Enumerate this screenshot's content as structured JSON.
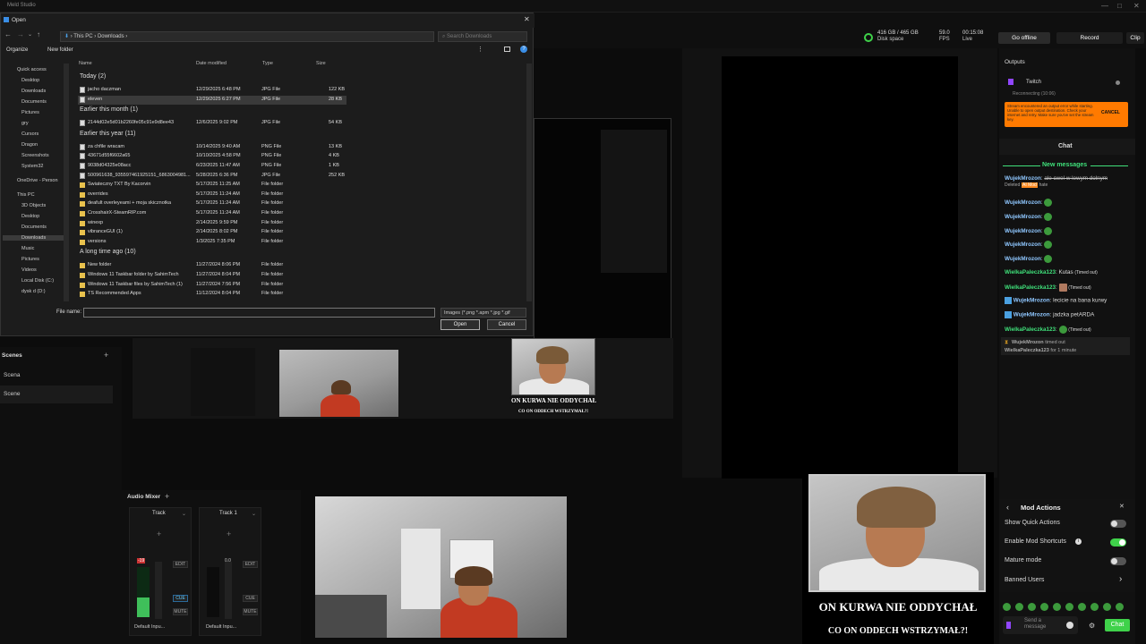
{
  "app": {
    "title": "Meld Studio"
  },
  "topbar": {
    "disk_space": "416 GB / 465 GB",
    "disk_label": "Disk space",
    "fps_value": "59.0",
    "fps_label": "FPS",
    "live_time": "00:15:08",
    "live_label": "Live",
    "go_offline": "Go offline",
    "record": "Record",
    "clip": "Clip"
  },
  "dialog": {
    "title": "Open",
    "breadcrumb": [
      "This PC",
      "Downloads"
    ],
    "search_placeholder": "Search Downloads",
    "organize": "Organize",
    "new_folder": "New folder",
    "columns": [
      "Name",
      "Date modified",
      "Type",
      "Size"
    ],
    "nav": [
      "Quick access",
      "Desktop",
      "Downloads",
      "Documents",
      "Pictures",
      "gry",
      "Cursors",
      "Dragon",
      "Screenshots",
      "System32",
      "OneDrive - Person",
      "This PC",
      "3D Objects",
      "Desktop",
      "Documents",
      "Downloads",
      "Music",
      "Pictures",
      "Videos",
      "Local Disk (C:)",
      "dysk d (D:)"
    ],
    "groups": [
      {
        "label": "Today (2)",
        "files": [
          {
            "name": "jacho daczman",
            "date": "12/29/2025 6:48 PM",
            "type": "JPG File",
            "size": "122 KB",
            "kind": "img"
          },
          {
            "name": "eleven",
            "date": "12/29/2025 6:27 PM",
            "type": "JPG File",
            "size": "28 KB",
            "kind": "img",
            "selected": true
          }
        ]
      },
      {
        "label": "Earlier this month (1)",
        "files": [
          {
            "name": "2144d02e5d01b2260fe05c91e9d8ee43",
            "date": "12/6/2025 9:02 PM",
            "type": "JPG File",
            "size": "54 KB",
            "kind": "img"
          }
        ]
      },
      {
        "label": "Earlier this year (11)",
        "files": [
          {
            "name": "za chfile wracam",
            "date": "10/14/2025 9:40 AM",
            "type": "PNG File",
            "size": "13 KB",
            "kind": "img"
          },
          {
            "name": "43671d55f6602a65",
            "date": "10/10/2025 4:58 PM",
            "type": "PNG File",
            "size": "4 KB",
            "kind": "img"
          },
          {
            "name": "9038d04325e08acc",
            "date": "6/23/2025 11:47 AM",
            "type": "PNG File",
            "size": "1 KB",
            "kind": "img"
          },
          {
            "name": "500961638_935597461925151_6863004981...",
            "date": "5/28/2025 6:36 PM",
            "type": "JPG File",
            "size": "252 KB",
            "kind": "img"
          },
          {
            "name": "Swiateczny TXT By Kacorvin",
            "date": "5/17/2025 11:25 AM",
            "type": "File folder",
            "size": "",
            "kind": "fold"
          },
          {
            "name": "overrides",
            "date": "5/17/2025 11:24 AM",
            "type": "File folder",
            "size": "",
            "kind": "fold"
          },
          {
            "name": "deafult overleyeami + moja skicznotka",
            "date": "5/17/2025 11:24 AM",
            "type": "File folder",
            "size": "",
            "kind": "fold"
          },
          {
            "name": "CrosshairX-SteamRIP.com",
            "date": "5/17/2025 11:24 AM",
            "type": "File folder",
            "size": "",
            "kind": "fold"
          },
          {
            "name": "winexp",
            "date": "2/14/2025 9:59 PM",
            "type": "File folder",
            "size": "",
            "kind": "fold"
          },
          {
            "name": "vibranceGUI (1)",
            "date": "2/14/2025 8:02 PM",
            "type": "File folder",
            "size": "",
            "kind": "fold"
          },
          {
            "name": "versions",
            "date": "1/3/2025 7:35 PM",
            "type": "File folder",
            "size": "",
            "kind": "fold"
          }
        ]
      },
      {
        "label": "A long time ago (10)",
        "files": [
          {
            "name": "New folder",
            "date": "11/27/2024 8:06 PM",
            "type": "File folder",
            "size": "",
            "kind": "fold"
          },
          {
            "name": "Windows 11 Taskbar folder by SahimTech",
            "date": "11/27/2024 8:04 PM",
            "type": "File folder",
            "size": "",
            "kind": "fold"
          },
          {
            "name": "Windows 11 Taskbar files by SahimTech (1)",
            "date": "11/27/2024 7:56 PM",
            "type": "File folder",
            "size": "",
            "kind": "fold"
          },
          {
            "name": "TS Recommended Apps",
            "date": "11/12/2024 8:04 PM",
            "type": "File folder",
            "size": "",
            "kind": "fold"
          }
        ]
      }
    ],
    "file_name_label": "File name:",
    "file_name_value": "",
    "file_type": "Images (*.png *.apm *.jpg *.gif",
    "open": "Open",
    "cancel": "Cancel"
  },
  "scenes": {
    "title": "Scenes",
    "items": [
      "Scena",
      "Scene"
    ]
  },
  "audio": {
    "title": "Audio Mixer",
    "tracks": [
      {
        "name": "Track",
        "level": "-19",
        "device": "Default Inpu..."
      },
      {
        "name": "Track 1",
        "level": "0.0",
        "device": "Default Inpu..."
      }
    ],
    "edit": "EDIT",
    "cue": "CUE",
    "mute": "MUTE"
  },
  "outputs": {
    "title": "Outputs",
    "service": "Twitch",
    "status": "Reconnecting (10:06)",
    "error": "Stream encountered an output error while starting. Unable to open output destination. Check your internet and retry. Make sure you've set the stream key.",
    "cancel": "CANCEL"
  },
  "chat": {
    "title": "Chat",
    "new_messages": "New messages",
    "messages": [
      {
        "user": "WujekMrozon",
        "text": "ale cwel w lewym dolnym",
        "tags": [
          "Deleted",
          "AI Mod",
          "hate"
        ]
      },
      {
        "user": "WujekMrozon",
        "text": ""
      },
      {
        "user": "WujekMrozon",
        "text": ""
      },
      {
        "user": "WujekMrozon",
        "text": ""
      },
      {
        "user": "WujekMrozon",
        "text": ""
      },
      {
        "user": "WujekMrozon",
        "text": ""
      },
      {
        "user": "WielkaPaleczka123",
        "text": "Kutas",
        "tags": [
          "Timed out"
        ]
      },
      {
        "user": "WielkaPaleczka123",
        "text": "",
        "tags": [
          "Timed out"
        ]
      },
      {
        "user": "WujekMrozon",
        "text": "lecicie na bana kurwy"
      },
      {
        "user": "WujekMrozon",
        "text": "jadzka petARDA"
      },
      {
        "user": "WielkaPaleczka123",
        "text": "",
        "tags": [
          "Timed out"
        ]
      }
    ],
    "notice_user": "WujekMrozon",
    "notice_action": "timed out",
    "notice_target": "WielkaPaleczka123",
    "notice_duration": "for 1 minute",
    "send_placeholder": "Send a message",
    "chat_button": "Chat"
  },
  "mod": {
    "title": "Mod Actions",
    "items": [
      {
        "label": "Show Quick Actions",
        "on": false
      },
      {
        "label": "Enable Mod Shortcuts",
        "on": true
      },
      {
        "label": "Mature mode",
        "on": false
      },
      {
        "label": "Banned Users",
        "on": null
      }
    ]
  },
  "overlay": {
    "caption1": "ON KURWA NIE ODDYCHAŁ",
    "caption2": "CO ON ODDECH WSTRZYMAŁ?!"
  },
  "colors": {
    "accent_green": "#3fd24a",
    "go_offline_bg": "#2b2b2b",
    "error_bg": "#ff7a00",
    "ai_mod": "#ff8a1f"
  }
}
